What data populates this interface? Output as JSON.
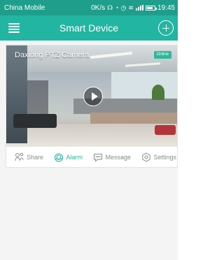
{
  "status_bar": {
    "carrier": "China Mobile",
    "net_speed": "0K/s",
    "time": "19:45"
  },
  "app_bar": {
    "title": "Smart Device",
    "menu_icon": "menu-icon",
    "add_icon": "add-icon"
  },
  "camera_card": {
    "name": "Daxiong PTZ Camera",
    "status": "Online",
    "play_icon": "play-icon"
  },
  "actions": [
    {
      "label": "Share",
      "icon": "share-icon"
    },
    {
      "label": "Alarm",
      "icon": "alarm-icon"
    },
    {
      "label": "Message",
      "icon": "message-icon"
    },
    {
      "label": "Settings",
      "icon": "settings-icon"
    }
  ],
  "colors": {
    "status_bar": "#1f9e8c",
    "app_bar": "#22b5a1",
    "accent": "#27b3a0",
    "online_badge": "#2fb899",
    "inactive_text": "#8a8a8a"
  }
}
